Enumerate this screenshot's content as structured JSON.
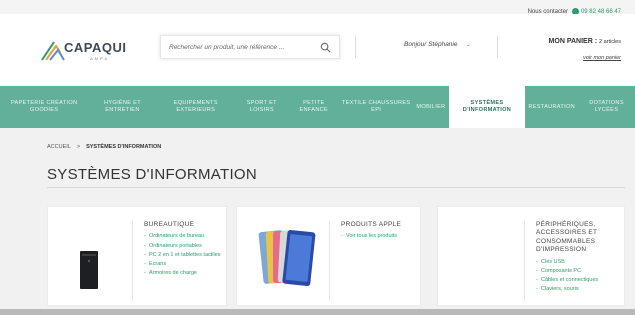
{
  "contact": {
    "label": "Nous contacter",
    "phone": "09 82 48 66 47"
  },
  "logo": {
    "name": "CAPAQUI",
    "sub": "AMPA"
  },
  "search": {
    "placeholder": "Rechercher un produit, une référence ..."
  },
  "greeting": "Bonjour Stéphanie",
  "cart": {
    "title": "MON PANIER :",
    "count": "2 articles",
    "link": "voir mon panier"
  },
  "nav": [
    {
      "label": "PAPETERIE CRÉATION GOODIES",
      "active": false
    },
    {
      "label": "HYGIÈNE ET ENTRETIEN",
      "active": false
    },
    {
      "label": "EQUIPEMENTS EXTERIEURS",
      "active": false
    },
    {
      "label": "SPORT ET LOISIRS",
      "active": false
    },
    {
      "label": "PETITE ENFANCE",
      "active": false
    },
    {
      "label": "TEXTILE CHAUSSURES EPI",
      "active": false
    },
    {
      "label": "MOBILIER",
      "active": false
    },
    {
      "label": "SYSTÈMES D'INFORMATION",
      "active": true
    },
    {
      "label": "RESTAURATION",
      "active": false
    },
    {
      "label": "DOTATIONS LYCÉES",
      "active": false
    }
  ],
  "breadcrumb": {
    "home": "ACCUEIL",
    "sep": ">",
    "current": "SYSTÈMES D'INFORMATION"
  },
  "page_title": "SYSTÈMES D'INFORMATION",
  "cards": {
    "bureautique": {
      "title": "BUREAUTIQUE",
      "items": [
        "Ordinateurs de bureau",
        "Ordinateurs portables",
        "PC 2 en 1 et tablettes tactiles",
        "Ecrans",
        "Armoires de charge"
      ]
    },
    "apple": {
      "title": "PRODUITS APPLE",
      "items": [
        "Voir tous les produits"
      ]
    },
    "peripheriques": {
      "title": "PÉRIPHÉRIQUES, ACCESSOIRES ET CONSOMMABLES D'IMPRESSION",
      "items": [
        "Clés USB",
        "Composants PC",
        "Câbles et connectiques",
        "Claviers, souris"
      ]
    }
  },
  "colors": {
    "nav_bg": "#62b099",
    "accent": "#2f9a6a"
  }
}
